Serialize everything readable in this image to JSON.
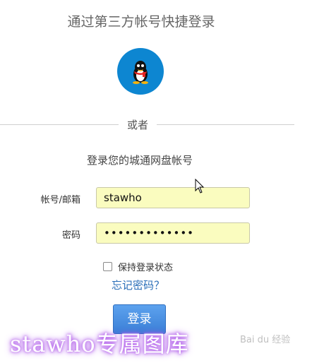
{
  "header": {
    "title": "通过第三方帐号快捷登录"
  },
  "divider": {
    "or_text": "或者"
  },
  "form": {
    "subtitle": "登录您的城通网盘帐号",
    "account_label": "帐号/邮箱",
    "account_value": "stawho",
    "password_label": "密码",
    "password_value": "•••••••••••••",
    "remember_label": "保持登录状态",
    "forgot_label": "忘记密码？",
    "login_label": "登录"
  },
  "overlay": {
    "watermark": "stawho专属图库",
    "baidu": "Bai du 经验"
  },
  "icons": {
    "social": "qq-penguin-icon",
    "pointer": "mouse-cursor-icon"
  },
  "colors": {
    "qq_blue": "#0d86d1",
    "button_blue": "#3a7fd6",
    "link_blue": "#2a6eb8",
    "field_bg": "#fafcbf"
  }
}
